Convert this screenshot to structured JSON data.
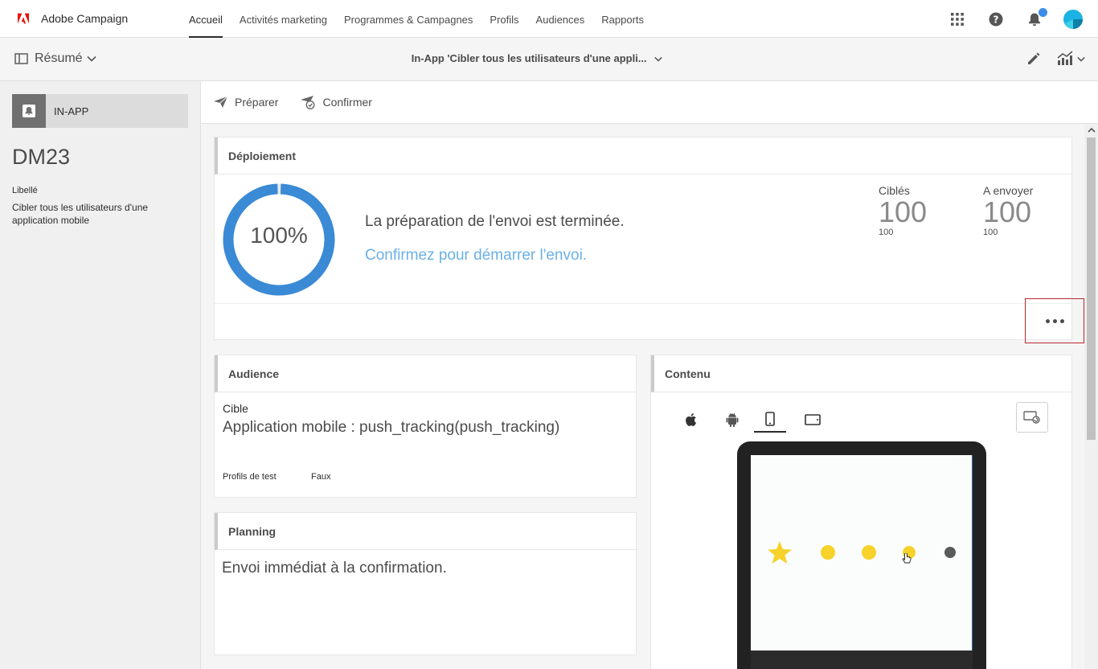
{
  "app": {
    "brand": "Adobe Campaign"
  },
  "nav": {
    "items": [
      "Accueil",
      "Activités marketing",
      "Programmes & Campagnes",
      "Profils",
      "Audiences",
      "Rapports"
    ],
    "active_index": 0
  },
  "topbar": {
    "icons": [
      "apps-grid-icon",
      "help-icon",
      "bell-icon",
      "avatar"
    ]
  },
  "subbar": {
    "summary_label": "Résumé",
    "title": "In-App 'Cibler tous les utilisateurs d'une appli..."
  },
  "left": {
    "channel": "IN-APP",
    "delivery_id": "DM23",
    "label_caption": "Libellé",
    "label_value": "Cibler tous les utilisateurs d'une application mobile"
  },
  "toolbar": {
    "prepare": "Préparer",
    "confirm": "Confirmer"
  },
  "deployment": {
    "header": "Déploiement",
    "percent_text": "100%",
    "progress": 1.0,
    "message": "La préparation de l'envoi est terminée.",
    "link": "Confirmez pour démarrer l'envoi.",
    "targeted": {
      "label": "Ciblés",
      "value": "100",
      "sub": "100"
    },
    "to_send": {
      "label": "A envoyer",
      "value": "100",
      "sub": "100"
    }
  },
  "audience": {
    "header": "Audience",
    "cible_label": "Cible",
    "cible_value": "Application mobile : push_tracking(push_tracking)",
    "test_profiles_label": "Profils de test",
    "test_profiles_value": "Faux"
  },
  "planning": {
    "header": "Planning",
    "text": "Envoi immédiat à la confirmation."
  },
  "contenu": {
    "header": "Contenu",
    "device_tabs": [
      "apple-icon",
      "android-icon",
      "phone-icon",
      "tablet-icon"
    ],
    "active_device_tab": 2,
    "rating_filled": 4,
    "rating_total": 5
  },
  "colors": {
    "accent_blue": "#3b8ee8",
    "link_blue": "#6bb0e6",
    "adobe_red": "#eb1000",
    "highlight_red": "#b6282d",
    "star_yellow": "#f6d22a"
  }
}
